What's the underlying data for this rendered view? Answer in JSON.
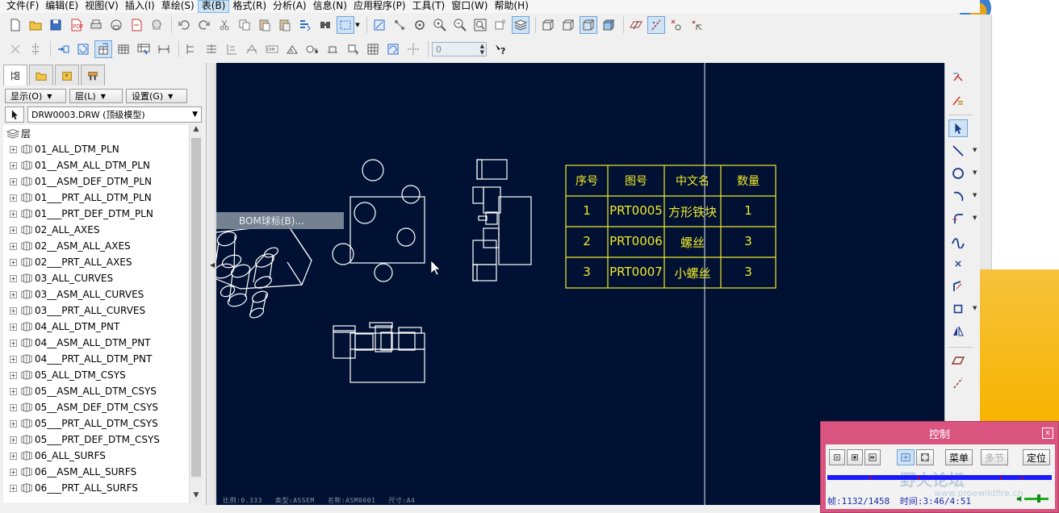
{
  "menubar": {
    "items": [
      "文件(F)",
      "编辑(E)",
      "视图(V)",
      "插入(I)",
      "草绘(S)",
      "表(B)",
      "格式(R)",
      "分析(A)",
      "信息(N)",
      "应用程序(P)",
      "工具(T)",
      "窗口(W)",
      "帮助(H)"
    ],
    "active_index": 5
  },
  "toolbar": {
    "spin_value": "0"
  },
  "left_panel": {
    "display_label": "显示(O)",
    "layer_label": "层(L)",
    "settings_label": "设置(G)",
    "model_label": "DRW0003.DRW (顶级模型)",
    "tree_root": "层",
    "tree_items": [
      "01_ALL_DTM_PLN",
      "01__ASM_ALL_DTM_PLN",
      "01__ASM_DEF_DTM_PLN",
      "01___PRT_ALL_DTM_PLN",
      "01___PRT_DEF_DTM_PLN",
      "02_ALL_AXES",
      "02__ASM_ALL_AXES",
      "02___PRT_ALL_AXES",
      "03_ALL_CURVES",
      "03__ASM_ALL_CURVES",
      "03___PRT_ALL_CURVES",
      "04_ALL_DTM_PNT",
      "04__ASM_ALL_DTM_PNT",
      "04___PRT_ALL_DTM_PNT",
      "05_ALL_DTM_CSYS",
      "05__ASM_ALL_DTM_CSYS",
      "05__ASM_DEF_DTM_CSYS",
      "05___PRT_ALL_DTM_CSYS",
      "05___PRT_DEF_DTM_CSYS",
      "06_ALL_SURFS",
      "06__ASM_ALL_SURFS",
      "06___PRT_ALL_SURFS"
    ]
  },
  "canvas": {
    "bom_menu_item": "BOM球标(B)...",
    "status": [
      "比例:0.333",
      "类型:ASSEM",
      "名称:ASM0001",
      "尺寸:A4"
    ],
    "bom_table": {
      "headers": [
        "序号",
        "图号",
        "中文名",
        "数量"
      ],
      "rows": [
        [
          "1",
          "PRT0005",
          "方形铁块",
          "1"
        ],
        [
          "2",
          "PRT0006",
          "螺丝",
          "3"
        ],
        [
          "3",
          "PRT0007",
          "小螺丝",
          "3"
        ]
      ]
    }
  },
  "control_panel": {
    "title": "控制",
    "close_label": "x",
    "menu_label": "菜单",
    "section_label": "多节",
    "locate_label": "定位",
    "frame_info": "帧:1132/1458",
    "time_info": "时间:3:46/4:51",
    "watermark": "野火论坛",
    "watermark_url": "www.proewildfire.cn",
    "progress": 0.776
  },
  "colors": {
    "canvas_bg": "#001133",
    "table_text": "#f1e92a",
    "control_bg": "#d9557f"
  }
}
